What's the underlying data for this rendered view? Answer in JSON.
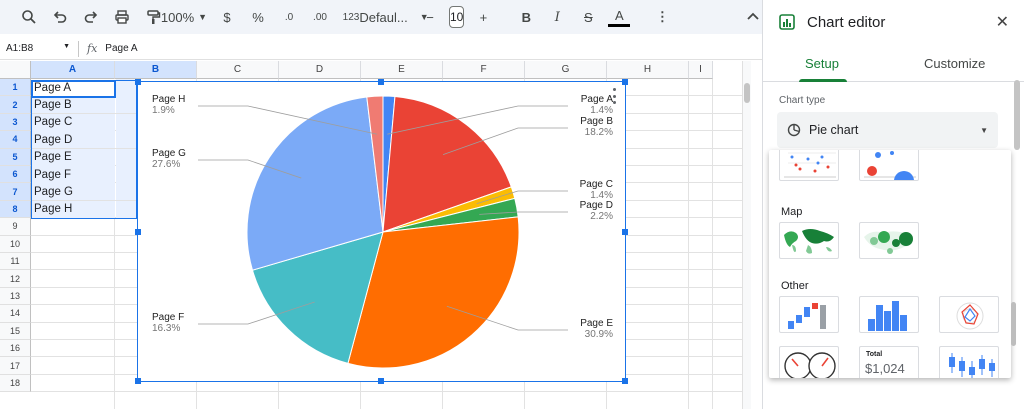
{
  "toolbar": {
    "zoom": "100%",
    "currency": "$",
    "percent": "%",
    "decimal_decrease": ".0",
    "decimal_increase": ".00",
    "number_format": "123",
    "font": "Defaul...",
    "font_size": "10",
    "minus": "−",
    "plus": "+",
    "bold": "B",
    "italic": "I",
    "strikethrough": "S",
    "text_color": "A",
    "more": "⋮",
    "collapse": "^"
  },
  "formula_bar": {
    "name_box": "A1:B8",
    "fx": "fx",
    "formula": "Page A"
  },
  "grid": {
    "columns": [
      "A",
      "B",
      "C",
      "D",
      "E",
      "F",
      "G",
      "H",
      "I"
    ],
    "rows": [
      "1",
      "2",
      "3",
      "4",
      "5",
      "6",
      "7",
      "8",
      "9",
      "10",
      "11",
      "12",
      "13",
      "14",
      "15",
      "16",
      "17",
      "18"
    ],
    "cells_a": [
      "Page A",
      "Page B",
      "Page C",
      "Page D",
      "Page E",
      "Page F",
      "Page G",
      "Page H"
    ]
  },
  "chart_data": {
    "type": "pie",
    "categories": [
      "Page A",
      "Page B",
      "Page C",
      "Page D",
      "Page E",
      "Page F",
      "Page G",
      "Page H"
    ],
    "values": [
      1.4,
      18.2,
      1.4,
      2.2,
      30.9,
      16.3,
      27.6,
      1.9
    ],
    "labels_pct": [
      "1.4%",
      "18.2%",
      "1.4%",
      "2.2%",
      "30.9%",
      "16.3%",
      "27.6%",
      "1.9%"
    ],
    "colors": [
      "#4285f4",
      "#ea4335",
      "#fbbc04",
      "#34a853",
      "#ff6d01",
      "#46bdc6",
      "#7baaf7",
      "#f07b72"
    ],
    "legend": "labeled"
  },
  "editor": {
    "title": "Chart editor",
    "close": "✕",
    "tabs": [
      "Setup",
      "Customize"
    ],
    "chart_type_label": "Chart type",
    "chart_type_value": "Pie chart",
    "section_map": "Map",
    "section_other": "Other",
    "scorecard_label": "Total",
    "scorecard_value": "$1,024"
  }
}
